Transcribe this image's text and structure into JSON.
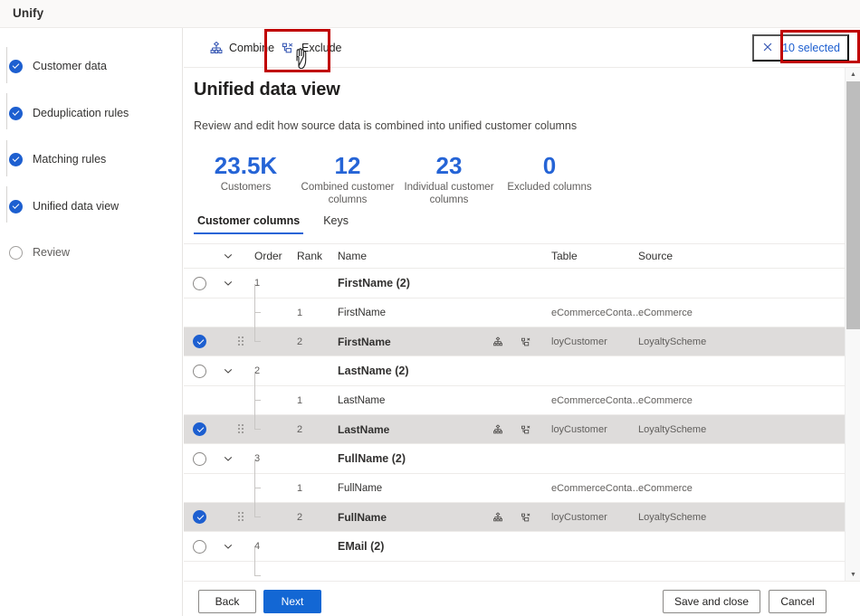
{
  "window": {
    "title": "Unify"
  },
  "sidebar": {
    "steps": [
      {
        "label": "Customer data",
        "state": "done"
      },
      {
        "label": "Deduplication rules",
        "state": "done"
      },
      {
        "label": "Matching rules",
        "state": "done"
      },
      {
        "label": "Unified data view",
        "state": "done"
      },
      {
        "label": "Review",
        "state": "pending"
      }
    ]
  },
  "commandbar": {
    "combine_label": "Combine",
    "combine_icon": "combine-icon",
    "exclude_label": "Exclude",
    "exclude_icon": "exclude-icon",
    "selection_label": "10 selected",
    "selection_icon": "close-x-icon",
    "accent": "#1d5fd0",
    "highlight_color": "#c00000"
  },
  "main": {
    "title": "Unified data view",
    "subtitle": "Review and edit how source data is combined into unified customer columns",
    "stats": [
      {
        "value": "23.5K",
        "caption": "Customers"
      },
      {
        "value": "12",
        "caption": "Combined customer columns"
      },
      {
        "value": "23",
        "caption": "Individual customer columns"
      },
      {
        "value": "0",
        "caption": "Excluded columns"
      }
    ],
    "tabs": [
      {
        "label": "Customer columns",
        "active": true
      },
      {
        "label": "Keys",
        "active": false
      }
    ],
    "table": {
      "headers": {
        "chevron": "",
        "order": "Order",
        "rank": "Rank",
        "name": "Name",
        "table": "Table",
        "source": "Source"
      },
      "rows": [
        {
          "kind": "group",
          "checked": false,
          "order": "1",
          "rank": "",
          "name": "FirstName (2)",
          "table": "",
          "source": ""
        },
        {
          "kind": "child",
          "checked": false,
          "order": "",
          "rank": "1",
          "name": "FirstName",
          "table": "eCommerceConta…",
          "source": "eCommerce"
        },
        {
          "kind": "child",
          "checked": true,
          "order": "",
          "rank": "2",
          "name": "FirstName",
          "table": "loyCustomer",
          "source": "LoyaltyScheme"
        },
        {
          "kind": "group",
          "checked": false,
          "order": "2",
          "rank": "",
          "name": "LastName (2)",
          "table": "",
          "source": ""
        },
        {
          "kind": "child",
          "checked": false,
          "order": "",
          "rank": "1",
          "name": "LastName",
          "table": "eCommerceConta…",
          "source": "eCommerce"
        },
        {
          "kind": "child",
          "checked": true,
          "order": "",
          "rank": "2",
          "name": "LastName",
          "table": "loyCustomer",
          "source": "LoyaltyScheme"
        },
        {
          "kind": "group",
          "checked": false,
          "order": "3",
          "rank": "",
          "name": "FullName (2)",
          "table": "",
          "source": ""
        },
        {
          "kind": "child",
          "checked": false,
          "order": "",
          "rank": "1",
          "name": "FullName",
          "table": "eCommerceConta…",
          "source": "eCommerce"
        },
        {
          "kind": "child",
          "checked": true,
          "order": "",
          "rank": "2",
          "name": "FullName",
          "table": "loyCustomer",
          "source": "LoyaltyScheme"
        },
        {
          "kind": "group",
          "checked": false,
          "order": "4",
          "rank": "",
          "name": "EMail (2)",
          "table": "",
          "source": ""
        }
      ]
    }
  },
  "footer": {
    "back": "Back",
    "next": "Next",
    "save_and_close": "Save and close",
    "cancel": "Cancel"
  }
}
